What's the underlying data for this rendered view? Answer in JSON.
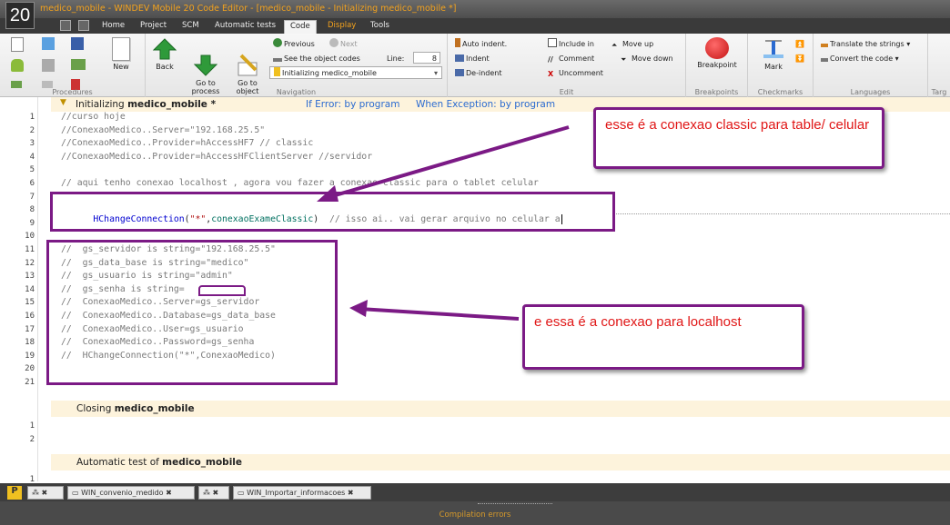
{
  "window": {
    "logo": "20",
    "title": "medico_mobile - WINDEV Mobile 20  Code Editor - [medico_mobile - Initializing medico_mobile *]"
  },
  "menu": {
    "tabs": [
      "Home",
      "Project",
      "SCM",
      "Automatic tests",
      "Code",
      "Display",
      "Tools"
    ],
    "active_tab": "Code"
  },
  "ribbon": {
    "procedures": {
      "label": "Procedures",
      "new": "New"
    },
    "navigation": {
      "label": "Navigation",
      "back": "Back",
      "go_process": "Go to\nprocess",
      "go_object": "Go to\nobject",
      "previous": "Previous",
      "next": "Next",
      "see_codes": "See the object codes",
      "line_label": "Line:",
      "line_value": "8",
      "combo_value": "Initializing medico_mobile"
    },
    "edit": {
      "label": "Edit",
      "auto_indent": "Auto indent.",
      "indent": "Indent",
      "de_indent": "De-indent",
      "include_in": "Include in",
      "comment": "Comment",
      "uncomment": "Uncomment",
      "move_up": "Move up",
      "move_down": "Move down"
    },
    "breakpoints": {
      "label": "Breakpoints",
      "breakpoint": "Breakpoint"
    },
    "checkmarks": {
      "label": "Checkmarks",
      "mark": "Mark"
    },
    "languages": {
      "label": "Languages",
      "translate": "Translate the strings",
      "convert": "Convert the code"
    },
    "target": {
      "label": "Targ"
    }
  },
  "editor": {
    "section1_title": "Initializing",
    "section1_name": "medico_mobile *",
    "if_error": "If Error: by program",
    "when_exception": "When Exception: by program",
    "lines": [
      "//curso hoje",
      "//ConexaoMedico..Server=\"192.168.25.5\"",
      "//ConexaoMedico..Provider=hAccessHF7 // classic",
      "//ConexaoMedico..Provider=hAccessHFClientServer //servidor",
      "",
      "// aqui tenho conexao localhost , agora vou fazer a conexao classic para o tablet celular",
      "",
      "",
      "",
      "",
      "//  gs_servidor is string=\"192.168.25.5\"",
      "//  gs_data_base is string=\"medico\"",
      "//  gs_usuario is string=\"admin\"",
      "//  gs_senha is string=",
      "//  ConexaoMedico..Server=gs_servidor",
      "//  ConexaoMedico..Database=gs_data_base",
      "//  ConexaoMedico..User=gs_usuario",
      "//  ConexaoMedico..Password=gs_senha",
      "//  HChangeConnection(\"*\",ConexaoMedico)",
      "",
      ""
    ],
    "line8": {
      "fn": "HChangeConnection",
      "open": "(",
      "str": "\"*\"",
      "comma": ",",
      "var": "conexaoExameClassic",
      "close": ")",
      "comment": "  // isso ai.. vai gerar arquivo no celular a"
    },
    "section2_title": "Closing",
    "section2_name": "medico_mobile",
    "section3_title": "Automatic test of",
    "section3_name": "medico_mobile"
  },
  "annotations": {
    "note1": "esse é a conexao classic para table/ celular",
    "note2": "e essa é a conexao para localhost"
  },
  "bottom_tabs": [
    "WIN_convenio_medido",
    "WIN_Importar_informacoes"
  ],
  "status": {
    "label": "Compilation errors"
  },
  "colors": {
    "accent": "#f3a21d",
    "annotation": "#7b1a85",
    "note_text": "#e01616"
  }
}
